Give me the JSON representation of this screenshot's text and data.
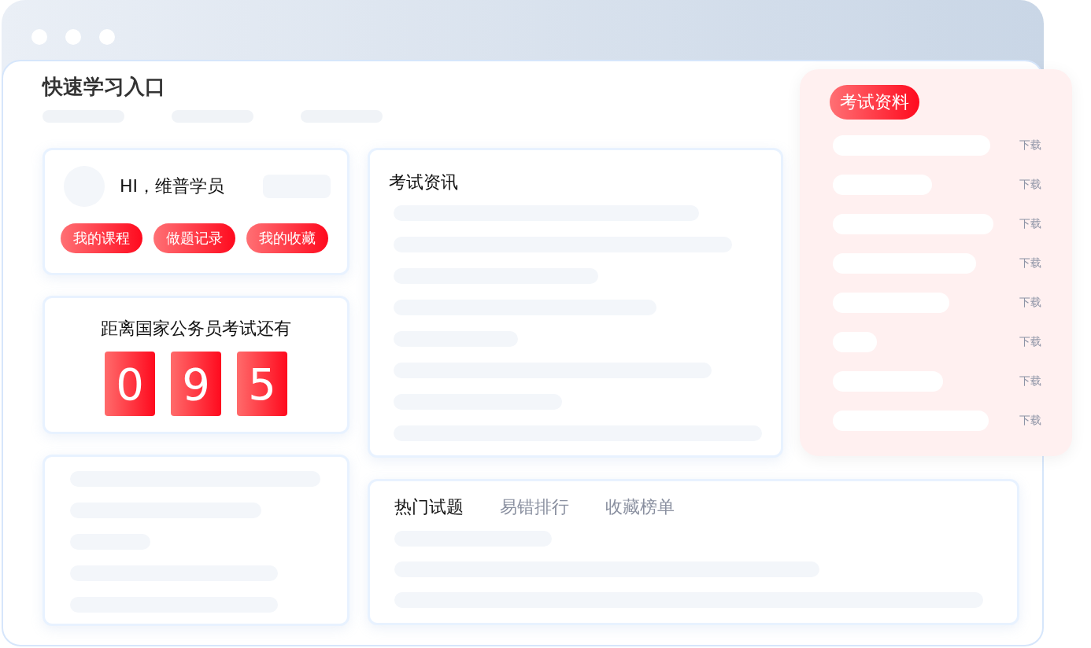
{
  "window": {
    "title": "快速学习入口"
  },
  "user_card": {
    "greeting": "HI，维普学员",
    "buttons": [
      "我的课程",
      "做题记录",
      "我的收藏"
    ]
  },
  "countdown": {
    "label": "距离国家公务员考试还有",
    "digits": [
      "0",
      "9",
      "5"
    ]
  },
  "news": {
    "title": "考试资讯"
  },
  "question_tabs": [
    {
      "label": "热门试题",
      "selected": true
    },
    {
      "label": "易错排行",
      "selected": false
    },
    {
      "label": "收藏榜单",
      "selected": false
    }
  ],
  "materials": {
    "title": "考试资料",
    "download_links": [
      "下载",
      "下载",
      "下载",
      "下载",
      "下载",
      "下载",
      "下载",
      "下载"
    ]
  }
}
